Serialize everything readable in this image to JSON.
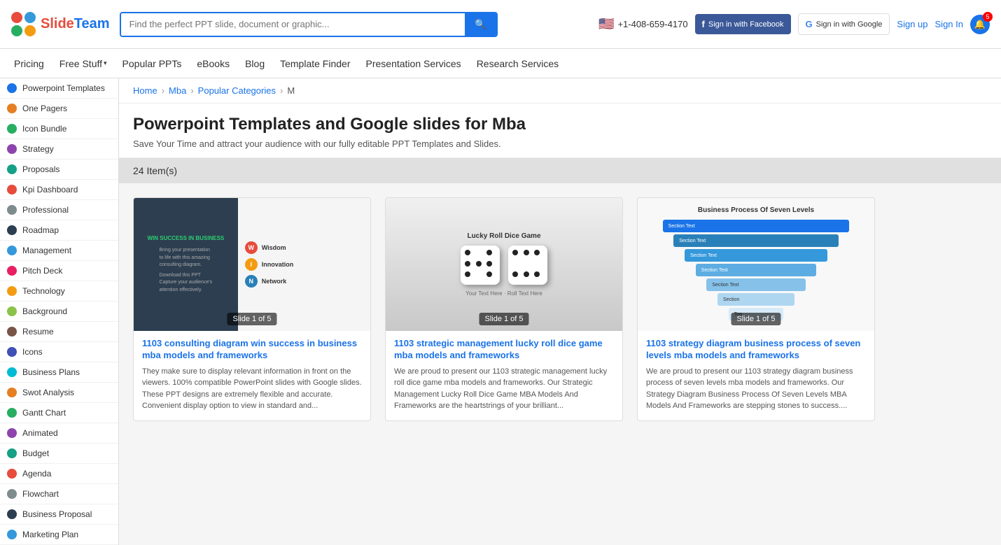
{
  "header": {
    "logo_slide": "Slide",
    "logo_team": "Team",
    "search_placeholder": "Find the perfect PPT slide, document or graphic...",
    "phone": "+1-408-659-4170",
    "fb_btn": "Sign in with Facebook",
    "google_btn": "Sign in with Google",
    "sign_up": "Sign up",
    "sign_in": "Sign In",
    "bell_count": "5"
  },
  "nav": {
    "items": [
      {
        "label": "Pricing",
        "id": "nav-pricing"
      },
      {
        "label": "Free Stuff",
        "id": "nav-free-stuff"
      },
      {
        "label": "Popular PPTs",
        "id": "nav-popular-ppts"
      },
      {
        "label": "eBooks",
        "id": "nav-ebooks"
      },
      {
        "label": "Blog",
        "id": "nav-blog"
      },
      {
        "label": "Template Finder",
        "id": "nav-template-finder"
      },
      {
        "label": "Presentation Services",
        "id": "nav-presentation-services"
      },
      {
        "label": "Research Services",
        "id": "nav-research-services"
      }
    ]
  },
  "sidebar": {
    "items": [
      {
        "label": "Powerpoint Templates",
        "id": "sidebar-powerpoint-templates",
        "color": "blue"
      },
      {
        "label": "One Pagers",
        "id": "sidebar-one-pagers",
        "color": "orange"
      },
      {
        "label": "Icon Bundle",
        "id": "sidebar-icon-bundle",
        "color": "green"
      },
      {
        "label": "Strategy",
        "id": "sidebar-strategy",
        "color": "purple"
      },
      {
        "label": "Proposals",
        "id": "sidebar-proposals",
        "color": "teal"
      },
      {
        "label": "Kpi Dashboard",
        "id": "sidebar-kpi-dashboard",
        "color": "red"
      },
      {
        "label": "Professional",
        "id": "sidebar-professional",
        "color": "gray"
      },
      {
        "label": "Roadmap",
        "id": "sidebar-roadmap",
        "color": "darkblue"
      },
      {
        "label": "Management",
        "id": "sidebar-management",
        "color": "lightblue"
      },
      {
        "label": "Pitch Deck",
        "id": "sidebar-pitch-deck",
        "color": "pink"
      },
      {
        "label": "Technology",
        "id": "sidebar-technology",
        "color": "yellow"
      },
      {
        "label": "Background",
        "id": "sidebar-background",
        "color": "lime"
      },
      {
        "label": "Resume",
        "id": "sidebar-resume",
        "color": "brown"
      },
      {
        "label": "Icons",
        "id": "sidebar-icons",
        "color": "indigo"
      },
      {
        "label": "Business Plans",
        "id": "sidebar-business-plans",
        "color": "cyan"
      },
      {
        "label": "Swot Analysis",
        "id": "sidebar-swot-analysis",
        "color": "orange"
      },
      {
        "label": "Gantt Chart",
        "id": "sidebar-gantt-chart",
        "color": "green"
      },
      {
        "label": "Animated",
        "id": "sidebar-animated",
        "color": "purple"
      },
      {
        "label": "Budget",
        "id": "sidebar-budget",
        "color": "teal"
      },
      {
        "label": "Agenda",
        "id": "sidebar-agenda",
        "color": "red"
      },
      {
        "label": "Flowchart",
        "id": "sidebar-flowchart",
        "color": "gray"
      },
      {
        "label": "Business Proposal",
        "id": "sidebar-business-proposal",
        "color": "darkblue"
      },
      {
        "label": "Marketing Plan",
        "id": "sidebar-marketing-plan",
        "color": "lightblue"
      }
    ]
  },
  "breadcrumb": {
    "home": "Home",
    "mba": "Mba",
    "popular_categories": "Popular Categories",
    "m": "M"
  },
  "page": {
    "title": "Powerpoint Templates and Google slides for Mba",
    "subtitle": "Save Your Time and attract your audience with our fully editable PPT Templates and Slides.",
    "item_count": "24 Item(s)"
  },
  "products": [
    {
      "id": "product-1",
      "title": "1103 consulting diagram win success in business mba models and frameworks",
      "description": "They make sure to display relevant information in front on the viewers. 100% compatible PowerPoint slides with Google slides. These PPT designs are extremely flexible and accurate. Convenient display option to view in standard and...",
      "slide_badge": "Slide 1 of 5"
    },
    {
      "id": "product-2",
      "title": "1103 strategic management lucky roll dice game mba models and frameworks",
      "description": "We are proud to present our 1103 strategic management lucky roll dice game mba models and frameworks. Our Strategic Management Lucky Roll Dice Game MBA Models And Frameworks are the heartstrings of your brilliant...",
      "slide_badge": "Slide 1 of 5"
    },
    {
      "id": "product-3",
      "title": "1103 strategy diagram business process of seven levels mba models and frameworks",
      "description": "We are proud to present our 1103 strategy diagram business process of seven levels mba models and frameworks. Our Strategy Diagram Business Process Of Seven Levels MBA Models And Frameworks are stepping stones to success....",
      "slide_badge": "Slide 1 of 5"
    }
  ]
}
